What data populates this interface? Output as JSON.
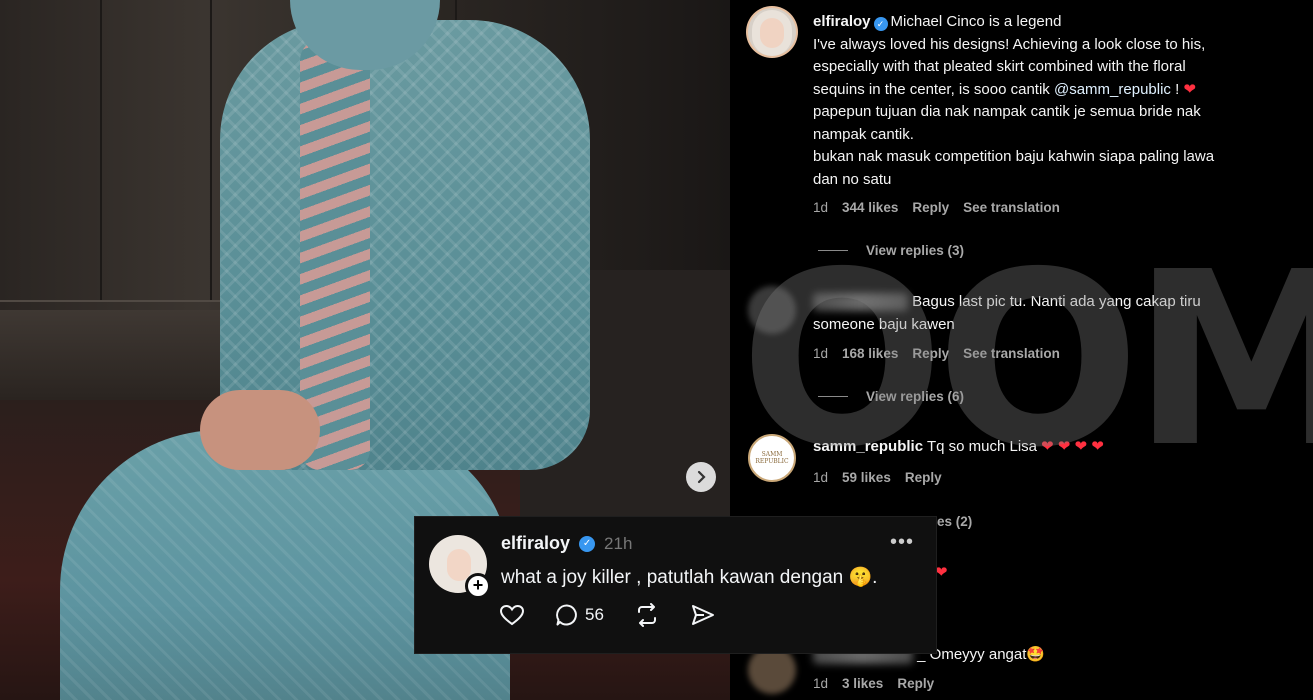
{
  "watermark": "OOM!",
  "comments": [
    {
      "username": "elfiraloy",
      "verified": true,
      "text_after": "Michael Cinco is a legend",
      "lines": [
        "I've always loved his designs! Achieving a look close to his,",
        "especially with that pleated skirt combined with the floral",
        "sequins in the center, is sooo cantik"
      ],
      "mention": "@samm_republic",
      "mention_tail": " ! ",
      "heart": "❤",
      "more_lines": [
        "papepun tujuan dia nak nampak cantik je semua bride nak",
        "nampak cantik.",
        "bukan nak masuk competition baju kahwin siapa paling lawa",
        "dan no satu"
      ],
      "age": "1d",
      "likes": "344 likes",
      "reply": "Reply",
      "translate": "See translation",
      "view_replies": "View replies (3)"
    },
    {
      "text_line1": "Bagus last pic tu. Nanti ada yang cakap tiru",
      "text_line2": "someone baju kawen",
      "age": "1d",
      "likes": "168 likes",
      "reply": "Reply",
      "translate": "See translation",
      "view_replies": "View replies (6)"
    },
    {
      "username": "samm_republic",
      "text": "Tq so much Lisa",
      "hearts": "❤ ❤ ❤ ❤",
      "avatar_text": "SAMM REPUBLIC",
      "age": "1d",
      "likes": "59 likes",
      "reply": "Reply",
      "view_replies_partial": "es (2)",
      "partial_heart": "❤"
    },
    {
      "text": "_ Omeyyy angat",
      "emoji": "🤩",
      "age": "1d",
      "likes": "3 likes",
      "reply": "Reply"
    }
  ],
  "thread": {
    "username": "elfiraloy",
    "time": "21h",
    "more": "•••",
    "text": "what a joy killer , patutlah kawan dengan",
    "text_emoji": "🤫",
    "text_end": ".",
    "reply_count": "56",
    "plus": "+"
  }
}
